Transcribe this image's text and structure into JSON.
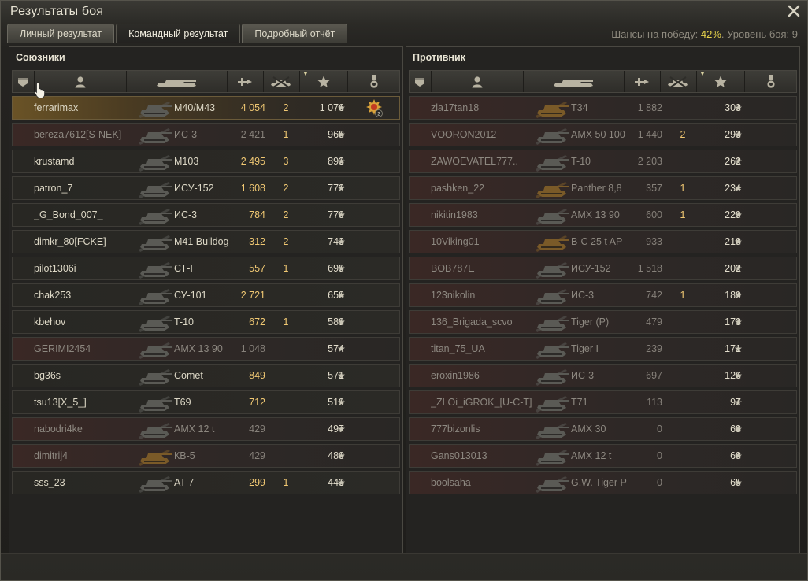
{
  "window": {
    "title": "Результаты боя"
  },
  "tabs": [
    {
      "label": "Личный результат"
    },
    {
      "label": "Командный результат"
    },
    {
      "label": "Подробный отчёт"
    }
  ],
  "odds": {
    "label": "Шансы на победу:",
    "value": "42%",
    "level_label": ". Уровень боя: 9"
  },
  "allies": {
    "title": "Союзники",
    "players": [
      {
        "name": "ferrarimax",
        "vehicle": "M40/M43",
        "damage": "4 054",
        "frags": "2",
        "xp": "1 076"
      },
      {
        "name": "bereza7612[S-NEK]",
        "vehicle": "ИС-3",
        "damage": "2 421",
        "frags": "1",
        "xp": "968"
      },
      {
        "name": "krustamd",
        "vehicle": "M103",
        "damage": "2 495",
        "frags": "3",
        "xp": "893"
      },
      {
        "name": "patron_7",
        "vehicle": "ИСУ-152",
        "damage": "1 608",
        "frags": "2",
        "xp": "772"
      },
      {
        "name": "_G_Bond_007_",
        "vehicle": "ИС-3",
        "damage": "784",
        "frags": "2",
        "xp": "770"
      },
      {
        "name": "dimkr_80[FCKE]",
        "vehicle": "M41 Bulldog",
        "damage": "312",
        "frags": "2",
        "xp": "743"
      },
      {
        "name": "pilot1306i",
        "vehicle": "СТ-I",
        "damage": "557",
        "frags": "1",
        "xp": "699"
      },
      {
        "name": "chak253",
        "vehicle": "СУ-101",
        "damage": "2 721",
        "frags": "",
        "xp": "658"
      },
      {
        "name": "kbehov",
        "vehicle": "T-10",
        "damage": "672",
        "frags": "1",
        "xp": "589"
      },
      {
        "name": "GERIMI2454",
        "vehicle": "AMX 13 90",
        "damage": "1 048",
        "frags": "",
        "xp": "574"
      },
      {
        "name": "bg36s",
        "vehicle": "Comet",
        "damage": "849",
        "frags": "",
        "xp": "571"
      },
      {
        "name": "tsu13[X_5_]",
        "vehicle": "T69",
        "damage": "712",
        "frags": "",
        "xp": "519"
      },
      {
        "name": "nabodri4ke",
        "vehicle": "AMX 12 t",
        "damage": "429",
        "frags": "",
        "xp": "497"
      },
      {
        "name": "dimitrij4",
        "vehicle": "КВ-5",
        "damage": "429",
        "frags": "",
        "xp": "480"
      },
      {
        "name": "sss_23",
        "vehicle": "AT 7",
        "damage": "299",
        "frags": "1",
        "xp": "443"
      }
    ]
  },
  "enemies": {
    "title": "Противник",
    "players": [
      {
        "name": "zla17tan18",
        "vehicle": "T34",
        "damage": "1 882",
        "frags": "",
        "xp": "303"
      },
      {
        "name": "VOORON2012",
        "vehicle": "AMX 50 100",
        "damage": "1 440",
        "frags": "2",
        "xp": "293"
      },
      {
        "name": "ZAWOEVATEL777..",
        "vehicle": "T-10",
        "damage": "2 203",
        "frags": "",
        "xp": "262"
      },
      {
        "name": "pashken_22",
        "vehicle": "Panther 8,8",
        "damage": "357",
        "frags": "1",
        "xp": "234"
      },
      {
        "name": "nikitin1983",
        "vehicle": "AMX 13 90",
        "damage": "600",
        "frags": "1",
        "xp": "229"
      },
      {
        "name": "10Viking01",
        "vehicle": "B-C 25 t AP",
        "damage": "933",
        "frags": "",
        "xp": "218"
      },
      {
        "name": "BOB787E",
        "vehicle": "ИСУ-152",
        "damage": "1 518",
        "frags": "",
        "xp": "202"
      },
      {
        "name": "123nikolin",
        "vehicle": "ИС-3",
        "damage": "742",
        "frags": "1",
        "xp": "189"
      },
      {
        "name": "136_Brigada_scvo",
        "vehicle": "Tiger (P)",
        "damage": "479",
        "frags": "",
        "xp": "173"
      },
      {
        "name": "titan_75_UA",
        "vehicle": "Tiger I",
        "damage": "239",
        "frags": "",
        "xp": "171"
      },
      {
        "name": "eroxin1986",
        "vehicle": "ИС-3",
        "damage": "697",
        "frags": "",
        "xp": "126"
      },
      {
        "name": "_ZLOi_iGROK_[U-C-T]",
        "vehicle": "T71",
        "damage": "113",
        "frags": "",
        "xp": "97"
      },
      {
        "name": "777bizonlis",
        "vehicle": "AMX 30",
        "damage": "0",
        "frags": "",
        "xp": "68"
      },
      {
        "name": "Gans013013",
        "vehicle": "AMX 12 t",
        "damage": "0",
        "frags": "",
        "xp": "68"
      },
      {
        "name": "boolsaha",
        "vehicle": "G.W. Tiger P",
        "damage": "0",
        "frags": "",
        "xp": "65"
      }
    ]
  },
  "star_glyph": "★",
  "medal": {
    "icon": "mastery-medal-icon",
    "count": "2"
  },
  "colors": {
    "accent_gold": "#e6d24a",
    "damage": "#f0c873",
    "premium_tank_tint": "#7a5a28"
  }
}
